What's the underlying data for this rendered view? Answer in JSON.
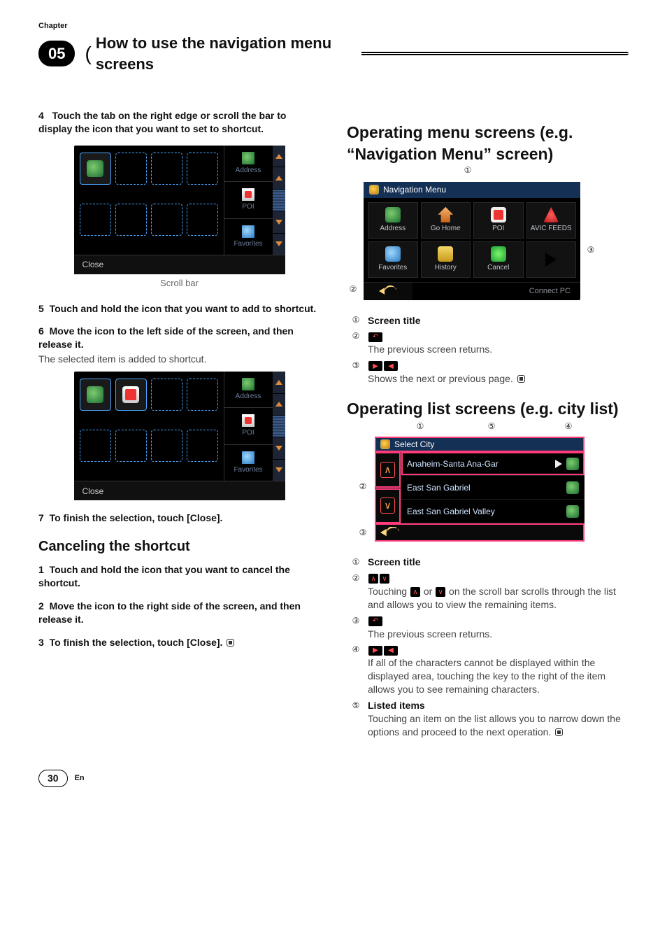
{
  "header": {
    "chapter_label": "Chapter",
    "chapter_number": "05",
    "section_title": "How to use the navigation menu screens"
  },
  "left": {
    "step4": {
      "num": "4",
      "text": "Touch the tab on the right edge or scroll the bar to display the icon that you want to set to shortcut."
    },
    "dev1": {
      "tabs": [
        "Address",
        "POI",
        "Favorites"
      ],
      "close": "Close"
    },
    "scrollbar_caption": "Scroll bar",
    "step5": {
      "num": "5",
      "text": "Touch and hold the icon that you want to add to shortcut."
    },
    "step6": {
      "num": "6",
      "text": "Move the icon to the left side of the screen, and then release it."
    },
    "step6_body": "The selected item is added to shortcut.",
    "dev2": {
      "tabs": [
        "Address",
        "POI",
        "Favorites"
      ],
      "close": "Close"
    },
    "step7": {
      "num": "7",
      "text": "To finish the selection, touch [Close]."
    },
    "cancel_heading": "Canceling the shortcut",
    "cstep1": {
      "num": "1",
      "text": "Touch and hold the icon that you want to cancel the shortcut."
    },
    "cstep2": {
      "num": "2",
      "text": "Move the icon to the right side of the screen, and then release it."
    },
    "cstep3": {
      "num": "3",
      "text": "To finish the selection, touch [Close]."
    }
  },
  "right": {
    "heading1a": "Operating menu screens (e.g.",
    "heading1b": "“",
    "heading1c": "Navigation Menu",
    "heading1d": "” screen)",
    "nav_dev": {
      "title": "Navigation Menu",
      "cells": [
        "Address",
        "Go Home",
        "POI",
        "AVIC FEEDS",
        "Favorites",
        "History",
        "Cancel",
        ""
      ],
      "connect": "Connect PC"
    },
    "nav_callouts": {
      "c1": {
        "num": "①",
        "label": "Screen title"
      },
      "c2": {
        "num": "②",
        "text": "The previous screen returns."
      },
      "c3": {
        "num": "③",
        "text": "Shows the next or previous page."
      }
    },
    "heading2": "Operating list screens (e.g. city list)",
    "list_dev": {
      "title": "Select City",
      "rows": [
        "Anaheim-Santa Ana-Gar",
        "East San Gabriel",
        "East San Gabriel Valley"
      ]
    },
    "list_callouts": {
      "c1": {
        "num": "①",
        "label": "Screen title"
      },
      "c2": {
        "num": "②",
        "text_a": "Touching ",
        "text_b": " or ",
        "text_c": " on the scroll bar scrolls through the list and allows you to view the remaining items."
      },
      "c3": {
        "num": "③",
        "text": "The previous screen returns."
      },
      "c4": {
        "num": "④",
        "text": "If all of the characters cannot be displayed within the displayed area, touching the key to the right of the item allows you to see remaining characters."
      },
      "c5": {
        "num": "⑤",
        "label": "Listed items",
        "text": "Touching an item on the list allows you to narrow down the options and proceed to the next operation."
      }
    }
  },
  "footer": {
    "page": "30",
    "lang": "En"
  },
  "annotations": {
    "a1": "①",
    "a2": "②",
    "a3": "③",
    "a4": "④",
    "a5": "⑤"
  }
}
